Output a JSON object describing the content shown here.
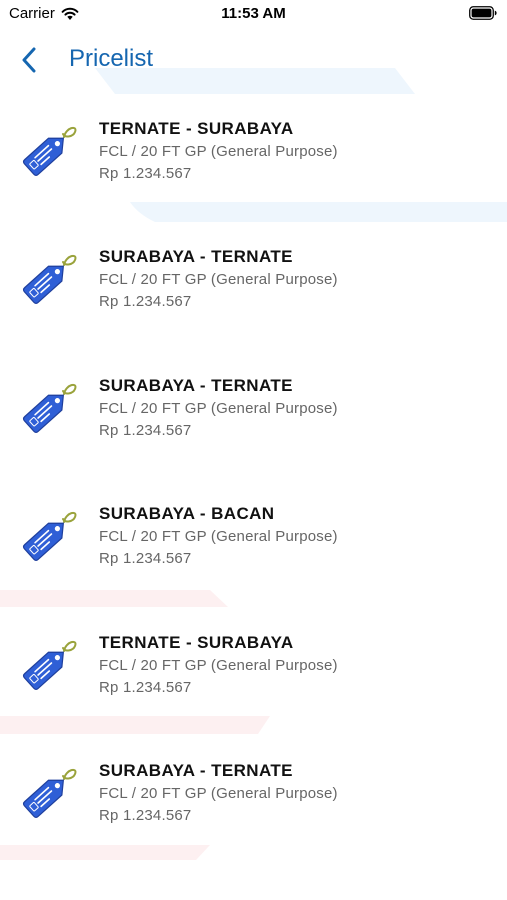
{
  "status_bar": {
    "carrier": "Carrier",
    "time": "11:53 AM"
  },
  "nav": {
    "title": "Pricelist",
    "back_icon": "chevron-left-icon"
  },
  "colors": {
    "accent": "#1566b0",
    "tag": "#2f5fd6",
    "tag_string": "#9aa33c"
  },
  "items": [
    {
      "route": "TERNATE - SURABAYA",
      "type": "FCL / 20 FT GP (General Purpose)",
      "price": "Rp 1.234.567"
    },
    {
      "route": "SURABAYA - TERNATE",
      "type": "FCL / 20 FT GP (General Purpose)",
      "price": "Rp 1.234.567"
    },
    {
      "route": "SURABAYA - TERNATE",
      "type": "FCL / 20 FT GP (General Purpose)",
      "price": "Rp 1.234.567"
    },
    {
      "route": "SURABAYA - BACAN",
      "type": "FCL / 20 FT GP (General Purpose)",
      "price": "Rp 1.234.567"
    },
    {
      "route": "TERNATE - SURABAYA",
      "type": "FCL / 20 FT GP (General Purpose)",
      "price": "Rp 1.234.567"
    },
    {
      "route": "SURABAYA - TERNATE",
      "type": "FCL / 20 FT GP (General Purpose)",
      "price": "Rp 1.234.567"
    }
  ]
}
